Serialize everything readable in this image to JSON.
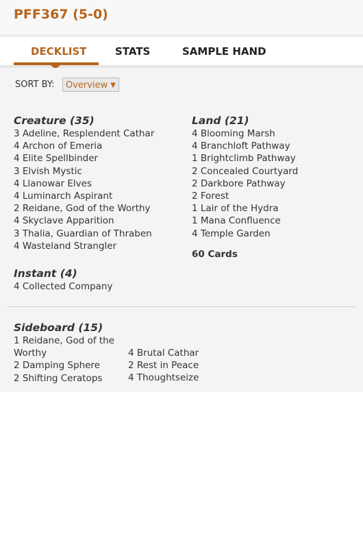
{
  "header": {
    "title": "PFF367 (5-0)"
  },
  "tabs": [
    {
      "label": "DECKLIST",
      "active": true
    },
    {
      "label": "STATS",
      "active": false
    },
    {
      "label": "SAMPLE HAND",
      "active": false
    }
  ],
  "sort": {
    "label": "SORT BY:",
    "value": "Overview"
  },
  "left": {
    "creature": {
      "heading": "Creature (35)",
      "cards": [
        "3 Adeline, Resplendent Cathar",
        "4 Archon of Emeria",
        "4 Elite Spellbinder",
        "3 Elvish Mystic",
        "4 Llanowar Elves",
        "4 Luminarch Aspirant",
        "2 Reidane, God of the Worthy",
        "4 Skyclave Apparition",
        "3 Thalia, Guardian of Thraben",
        "4 Wasteland Strangler"
      ]
    },
    "instant": {
      "heading": "Instant (4)",
      "cards": [
        "4 Collected Company"
      ]
    }
  },
  "right": {
    "land": {
      "heading": "Land (21)",
      "cards": [
        "4 Blooming Marsh",
        "4 Branchloft Pathway",
        "1 Brightclimb Pathway",
        "2 Concealed Courtyard",
        "2 Darkbore Pathway",
        "2 Forest",
        "1 Lair of the Hydra",
        "1 Mana Confluence",
        "4 Temple Garden"
      ]
    },
    "total": "60 Cards"
  },
  "sideboard": {
    "heading": "Sideboard (15)",
    "col1": [
      "1 Reidane, God of the Worthy",
      "2 Damping Sphere",
      "2 Shifting Ceratops"
    ],
    "col2": [
      "4 Brutal Cathar",
      "2 Rest in Peace",
      "4 Thoughtseize"
    ]
  },
  "colors": {
    "accent": "#b5651d",
    "panel": "#f4f4f4"
  }
}
